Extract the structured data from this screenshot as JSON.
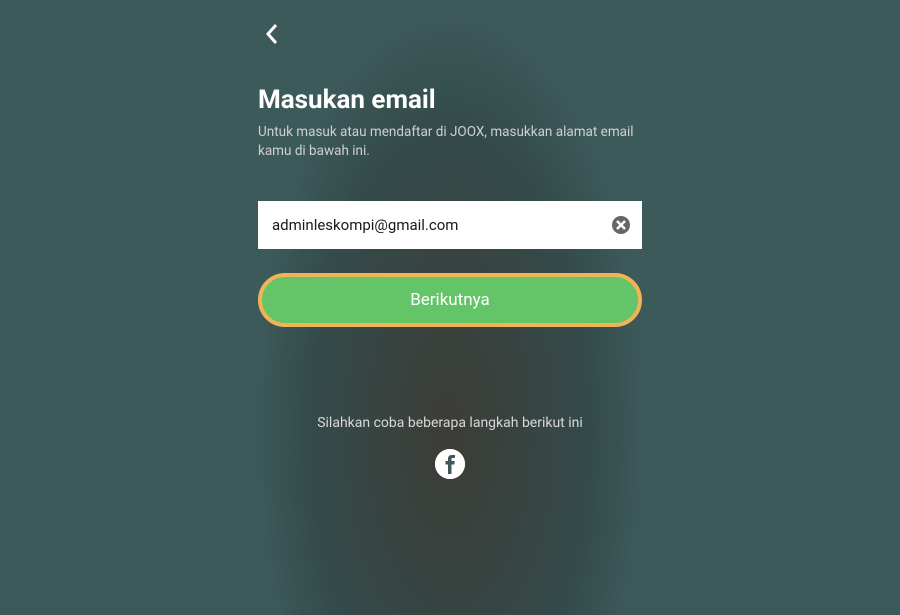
{
  "header": {
    "title": "Masukan email",
    "subtitle": "Untuk masuk atau mendaftar di JOOX, masukkan alamat email kamu di bawah ini."
  },
  "form": {
    "email_value": "adminleskompi@gmail.com",
    "email_placeholder": "",
    "next_label": "Berikutnya"
  },
  "alt": {
    "text": "Silahkan coba beberapa langkah berikut ini"
  },
  "icons": {
    "back": "chevron-left",
    "clear": "close",
    "social": "facebook"
  },
  "colors": {
    "background": "#3d5a5a",
    "button_bg": "#63c468",
    "button_border": "#f0b454",
    "text_primary": "#ffffff",
    "text_secondary": "#d0d0d0"
  }
}
